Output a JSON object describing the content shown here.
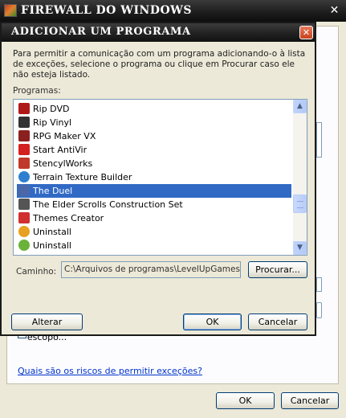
{
  "parent_window": {
    "title": "FIREWALL DO WINDOWS",
    "close_glyph": "✕",
    "risks_link": "Quais são os riscos de permitir exceções?",
    "ok_label": "OK",
    "cancel_label": "Cancelar"
  },
  "dialog": {
    "title": "ADICIONAR UM PROGRAMA",
    "close_glyph": "✕",
    "description": "Para permitir a comunicação com um programa adicionando-o à lista de exceções, selecione o programa ou clique em Procurar caso ele não esteja listado.",
    "programs_label": "Programas:",
    "programs": [
      {
        "label": "Rip DVD",
        "icon": "rip-dvd-icon",
        "color": "#b01818",
        "selected": false
      },
      {
        "label": "Rip Vinyl",
        "icon": "rip-vinyl-icon",
        "color": "#333333",
        "selected": false
      },
      {
        "label": "RPG Maker VX",
        "icon": "rpg-maker-icon",
        "color": "#8a2020",
        "selected": false
      },
      {
        "label": "Start AntiVir",
        "icon": "antivir-icon",
        "color": "#d42020",
        "selected": false
      },
      {
        "label": "StencylWorks",
        "icon": "stencyl-icon",
        "color": "#c0392b",
        "selected": false
      },
      {
        "label": "Terrain Texture Builder",
        "icon": "globe-icon",
        "color": "#2f7fd0",
        "selected": false
      },
      {
        "label": "The Duel",
        "icon": "the-duel-icon",
        "color": "#4a68a8",
        "selected": true
      },
      {
        "label": "The Elder Scrolls Construction Set",
        "icon": "construction-icon",
        "color": "#555555",
        "selected": false
      },
      {
        "label": "Themes Creator",
        "icon": "themes-icon",
        "color": "#d03030",
        "selected": false
      },
      {
        "label": "Uninstall",
        "icon": "uninstall-icon",
        "color": "#e8a020",
        "selected": false
      },
      {
        "label": "Uninstall",
        "icon": "uninstall-green-icon",
        "color": "#6ab23a",
        "selected": false
      }
    ],
    "path_label": "Caminho:",
    "path_value": "C:\\Arquivos de programas\\LevelUpGames\\Th",
    "browse_label": "Procurar...",
    "change_scope_label": "Alterar escopo...",
    "ok_label": "OK",
    "cancel_label": "Cancelar"
  },
  "colors": {
    "selection": "#316ac5",
    "title_bar": "#222222",
    "dialog_face": "#ece9d8"
  }
}
